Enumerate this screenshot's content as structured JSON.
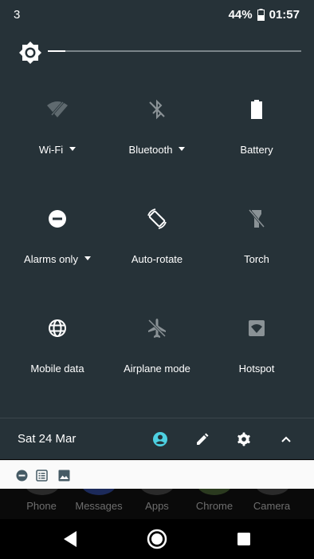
{
  "status_bar": {
    "notification_count": "3",
    "battery_percent": "44%",
    "time": "01:57"
  },
  "brightness": {
    "level": 0.07,
    "icon": "brightness-icon"
  },
  "tiles": [
    {
      "label": "Wi-Fi",
      "icon": "wifi-off-icon",
      "has_dropdown": true
    },
    {
      "label": "Bluetooth",
      "icon": "bluetooth-off-icon",
      "has_dropdown": true
    },
    {
      "label": "Battery",
      "icon": "battery-icon",
      "has_dropdown": false
    },
    {
      "label": "Alarms only",
      "icon": "do-not-disturb-icon",
      "has_dropdown": true
    },
    {
      "label": "Auto-rotate",
      "icon": "auto-rotate-icon",
      "has_dropdown": false
    },
    {
      "label": "Torch",
      "icon": "torch-off-icon",
      "has_dropdown": false
    },
    {
      "label": "Mobile data",
      "icon": "globe-icon",
      "has_dropdown": false
    },
    {
      "label": "Airplane mode",
      "icon": "airplane-icon",
      "has_dropdown": false
    },
    {
      "label": "Hotspot",
      "icon": "hotspot-icon",
      "has_dropdown": false
    }
  ],
  "footer": {
    "date": "Sat 24 Mar",
    "icons": [
      "user-icon",
      "edit-icon",
      "settings-icon",
      "chevron-up-icon"
    ]
  },
  "notification_icons": [
    "do-not-disturb-icon",
    "list-icon",
    "image-icon"
  ],
  "dock": {
    "apps": [
      "Phone",
      "Messages",
      "Apps",
      "Chrome",
      "Camera"
    ]
  },
  "navbar": {
    "buttons": [
      "back-icon",
      "home-icon",
      "recents-icon"
    ]
  },
  "colors": {
    "shade_bg": "#263238",
    "accent": "#4dd0e1",
    "disabled_icon": "#8a9296"
  }
}
